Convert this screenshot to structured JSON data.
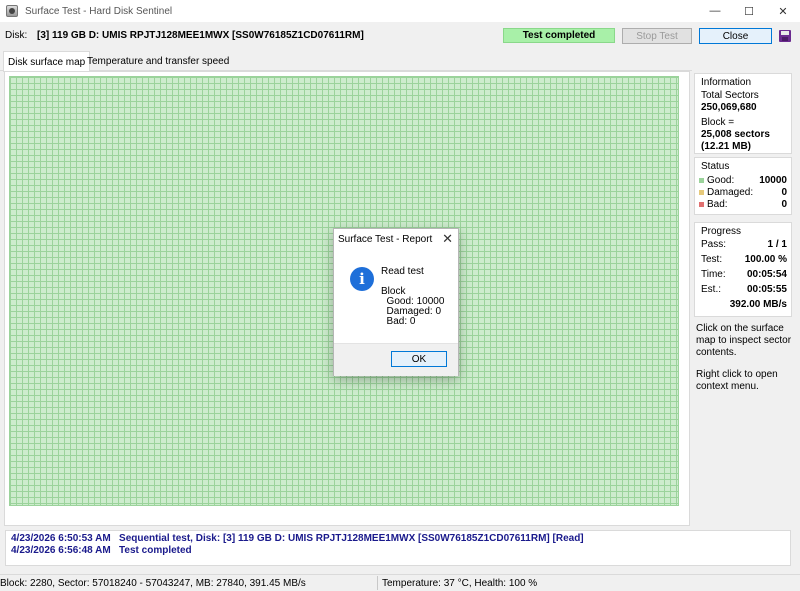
{
  "window": {
    "title": "Surface Test - Hard Disk Sentinel",
    "minimize": "—",
    "maximize": "☐",
    "close": "✕",
    "icon": "hard-disk-icon"
  },
  "disk": {
    "label": "Disk:",
    "value": "[3] 119 GB D: UMIS RPJTJ128MEE1MWX [SS0W76185Z1CD07611RM]"
  },
  "toolbar": {
    "status": "Test completed",
    "status_color": "#a8f0a8",
    "stop_test": "Stop Test",
    "close": "Close",
    "save_icon": "save-icon"
  },
  "tabs": [
    {
      "label": "Disk surface map"
    },
    {
      "label": "Temperature and transfer speed"
    }
  ],
  "surface_map": {
    "good_color": "#cdeccd",
    "good_blocks": 10000
  },
  "information": {
    "title": "Information",
    "total_sectors_label": "Total Sectors",
    "total_sectors_value": "250,069,680",
    "block_label": "Block =",
    "block_sectors": "25,008 sectors",
    "block_size": "(12.21 MB)"
  },
  "status": {
    "title": "Status",
    "items": [
      {
        "label": "Good:",
        "value": "10000",
        "color": "#9bd39b"
      },
      {
        "label": "Damaged:",
        "value": "0",
        "color": "#e6c97a"
      },
      {
        "label": "Bad:",
        "value": "0",
        "color": "#e07070"
      }
    ]
  },
  "progress": {
    "title": "Progress",
    "rows": [
      {
        "label": "Pass:",
        "value": "1 / 1"
      },
      {
        "label": "Test:",
        "value": "100.00 %"
      },
      {
        "label": "Time:",
        "value": "00:05:54"
      },
      {
        "label": "Est.:",
        "value": "00:05:55"
      }
    ],
    "speed": "392.00 MB/s"
  },
  "hints": {
    "click": "Click on the surface map to inspect sector contents.",
    "right_click": "Right click to open context menu."
  },
  "log": [
    {
      "time": "4/23/2026  6:50:53 AM",
      "text": "Sequential test, Disk: [3] 119 GB D: UMIS RPJTJ128MEE1MWX [SS0W76185Z1CD07611RM] [Read]"
    },
    {
      "time": "4/23/2026  6:56:48 AM",
      "text": "Test completed"
    }
  ],
  "statusbar": {
    "left": "Block: 2280, Sector: 57018240 - 57043247, MB: 27840, 391.45 MB/s",
    "right": "Temperature: 37  °C,  Health: 100 %"
  },
  "dialog": {
    "title": "Surface Test - Report",
    "icon": "info-icon",
    "lines": [
      "Read test",
      "",
      "Block",
      "  Good: 10000",
      "  Damaged: 0",
      "  Bad: 0"
    ],
    "ok": "OK"
  }
}
